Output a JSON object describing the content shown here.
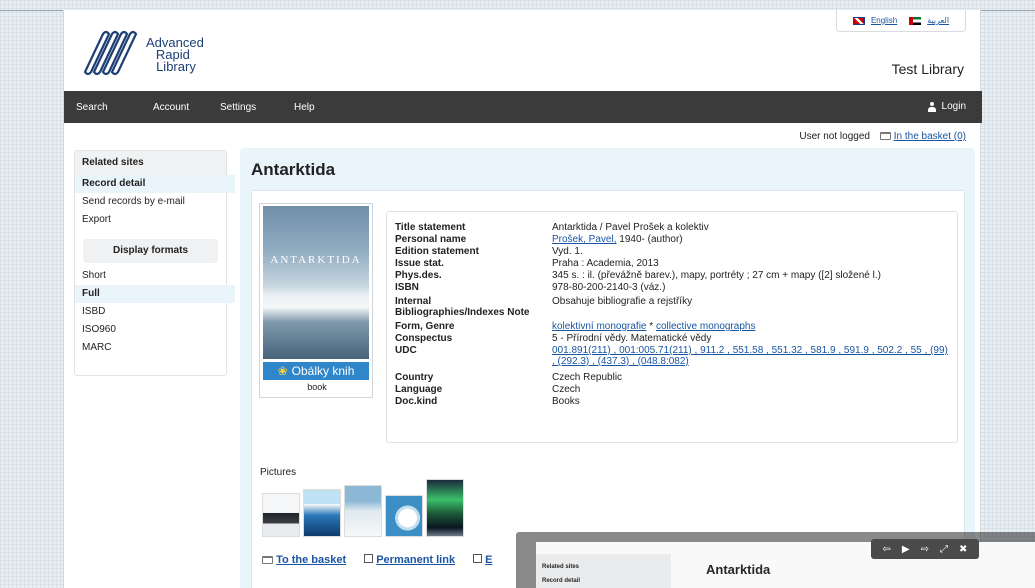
{
  "header": {
    "logo_lines": [
      "Advanced",
      "Rapid",
      "Library"
    ],
    "languages": [
      "English",
      "العربية"
    ],
    "library_name": "Test Library"
  },
  "nav": {
    "items": [
      "Search",
      "Account",
      "Settings",
      "Help"
    ],
    "login": "Login"
  },
  "status": {
    "user": "User not logged",
    "basket": "In the basket (0)"
  },
  "sidebar": {
    "related_title": "Related sites",
    "related_items": [
      "Record detail",
      "Send records by e-mail",
      "Export"
    ],
    "formats_title": "Display formats",
    "format_items": [
      "Short",
      "Full",
      "ISBD",
      "ISO960",
      "MARC"
    ]
  },
  "record": {
    "title": "Antarktida",
    "cover_title": "ANTARKTIDA",
    "obalky": "Obálky knih",
    "cover_caption": "book",
    "fields": [
      {
        "label": "Title statement",
        "value": "Antarktida / Pavel Prošek a kolektiv"
      },
      {
        "label": "Personal name",
        "value": "Prošek, Pavel,",
        "suffix": " 1940- (author)"
      },
      {
        "label": "Edition statement",
        "value": "Vyd. 1."
      },
      {
        "label": "Issue stat.",
        "value": "Praha : Academia, 2013"
      },
      {
        "label": "Phys.des.",
        "value": "345 s. : il. (převážně barev.), mapy, portréty ; 27 cm + mapy ([2] složené l.)"
      },
      {
        "label": "ISBN",
        "value": "978-80-200-2140-3 (váz.)"
      },
      {
        "label": "Internal Bibliographies/Indexes Note",
        "value": "Obsahuje bibliografie a rejstříky"
      },
      {
        "label": "Form, Genre",
        "value": "kolektivní monografie",
        "suffix": " * ",
        "value2": "collective monographs"
      },
      {
        "label": "Conspectus",
        "value": "5 - Přírodní vědy. Matematické vědy"
      },
      {
        "label": "UDC",
        "value": "001.891(211) , 001:005.71(211) , 911.2 , 551.58 , 551.32 , 581.9 , 591.9 , 502.2 , 55 , (99) , (292.3) , (437.3) , (048.8:082)"
      },
      {
        "label": "Country",
        "value": "Czech Republic"
      },
      {
        "label": "Language",
        "value": "Czech"
      },
      {
        "label": "Doc.kind",
        "value": "Books"
      }
    ],
    "pictures_label": "Pictures"
  },
  "actions": {
    "basket": "To the basket",
    "permalink": "Permanent link",
    "third": "E"
  },
  "overlay": {
    "side_label": "Related sites",
    "side_label2": "Record detail",
    "title": "Antarktida",
    "controls": [
      "⇦",
      "▶",
      "⇨",
      "⤢",
      "✖"
    ]
  },
  "colors": {
    "nav_bg": "#3b3b3b",
    "main_bg": "#eaf4fb",
    "link": "#1a55a3",
    "obalky": "#2f86c9"
  }
}
